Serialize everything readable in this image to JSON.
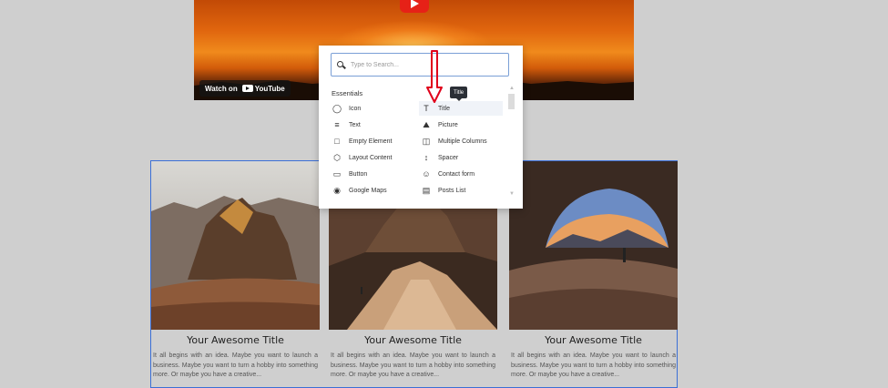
{
  "video": {
    "watch_on": "Watch on",
    "brand": "YouTube"
  },
  "popup": {
    "search_placeholder": "Type to Search...",
    "section": "Essentials",
    "tooltip": "Title",
    "items": [
      {
        "label": "Icon",
        "icon": "circle-icon"
      },
      {
        "label": "Title",
        "icon": "text-t-icon"
      },
      {
        "label": "Text",
        "icon": "lines-icon"
      },
      {
        "label": "Picture",
        "icon": "picture-icon"
      },
      {
        "label": "Empty Element",
        "icon": "square-icon"
      },
      {
        "label": "Multiple Columns",
        "icon": "columns-icon"
      },
      {
        "label": "Layout Content",
        "icon": "cube-icon"
      },
      {
        "label": "Spacer",
        "icon": "spacer-icon"
      },
      {
        "label": "Button",
        "icon": "button-icon"
      },
      {
        "label": "Contact form",
        "icon": "form-icon"
      },
      {
        "label": "Google Maps",
        "icon": "map-pin-icon"
      },
      {
        "label": "Posts List",
        "icon": "posts-icon"
      }
    ]
  },
  "cards": [
    {
      "title": "Your Awesome Title",
      "text": "It all begins with an idea. Maybe you want to launch a business. Maybe you want to turn a hobby into something more. Or maybe you have a creative..."
    },
    {
      "title": "Your Awesome Title",
      "text": "It all begins with an idea. Maybe you want to launch a business. Maybe you want to turn a hobby into something more. Or maybe you have a creative..."
    },
    {
      "title": "Your Awesome Title",
      "text": "It all begins with an idea. Maybe you want to launch a business. Maybe you want to turn a hobby into something more. Or maybe you have a creative..."
    }
  ],
  "colors": {
    "accent_border": "#3b6fd6",
    "annotation_arrow": "#e0001a"
  }
}
